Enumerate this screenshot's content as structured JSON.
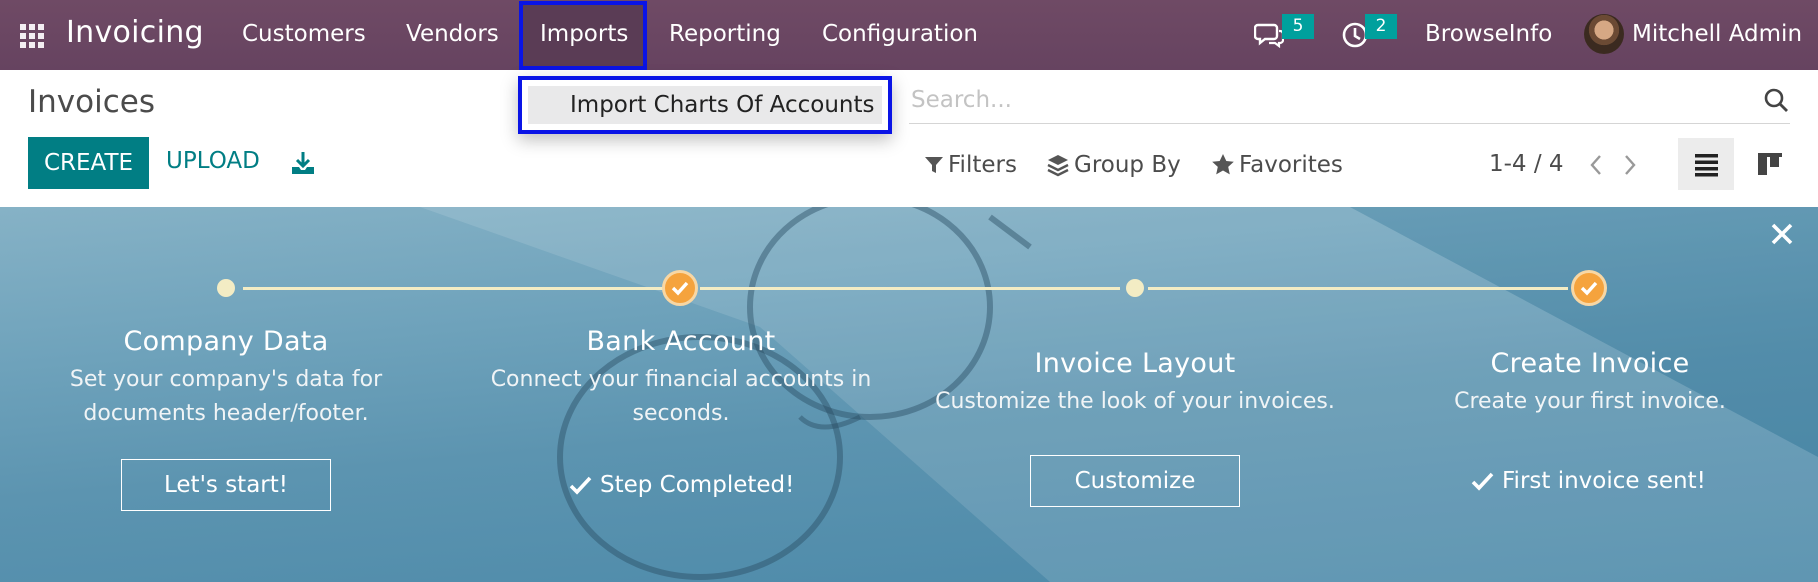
{
  "navbar": {
    "app_title": "Invoicing",
    "menu": [
      "Customers",
      "Vendors",
      "Imports",
      "Reporting",
      "Configuration"
    ],
    "messages_count": "5",
    "activities_count": "2",
    "company": "BrowseInfo",
    "user": "Mitchell Admin",
    "colors": {
      "navbar": "#714b67",
      "badge": "#00a09d",
      "highlight": "#0a14e6"
    }
  },
  "dropdown": {
    "items": [
      "Import Charts Of Accounts"
    ]
  },
  "control_panel": {
    "title": "Invoices",
    "create_label": "CREATE",
    "upload_label": "UPLOAD",
    "search_placeholder": "Search...",
    "filters_label": "Filters",
    "group_by_label": "Group By",
    "favorites_label": "Favorites",
    "pager": "1-4 / 4",
    "colors": {
      "primary": "#017e84"
    }
  },
  "onboarding": {
    "steps": [
      {
        "title": "Company Data",
        "desc1": "Set your company's data for",
        "desc2": "documents header/footer.",
        "action": "Let's start!",
        "done": false
      },
      {
        "title": "Bank Account",
        "desc1": "Connect your financial accounts in",
        "desc2": "seconds.",
        "action": "Step Completed!",
        "done": true
      },
      {
        "title": "Invoice Layout",
        "desc1": "Customize the look of your invoices.",
        "desc2": "",
        "action": "Customize",
        "done": false
      },
      {
        "title": "Create Invoice",
        "desc1": "Create your first invoice.",
        "desc2": "",
        "action": "First invoice sent!",
        "done": true
      }
    ],
    "colors": {
      "check": "#f5a33d",
      "line": "#f3ecc4"
    }
  }
}
